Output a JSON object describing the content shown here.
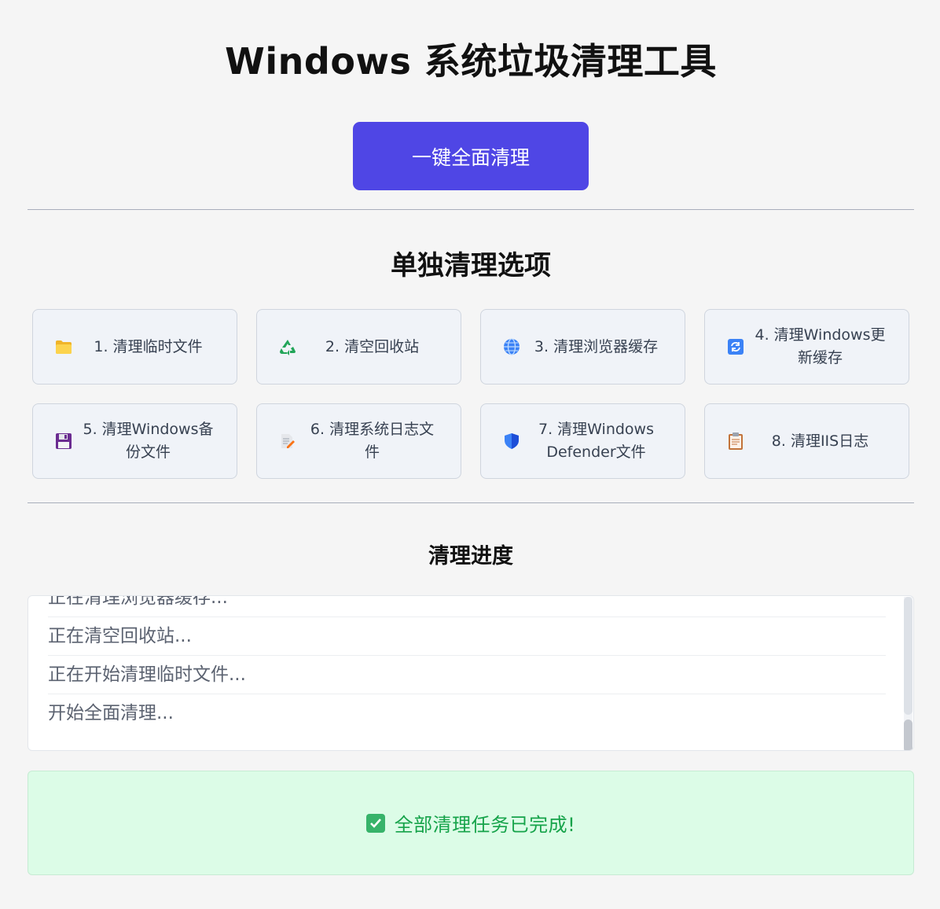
{
  "header": {
    "title": "Windows 系统垃圾清理工具",
    "clean_all_button": "一键全面清理"
  },
  "options": {
    "section_title": "单独清理选项",
    "items": [
      {
        "label": "1. 清理临时文件",
        "icon": "folder-icon"
      },
      {
        "label": "2. 清空回收站",
        "icon": "recycle-icon"
      },
      {
        "label": "3. 清理浏览器缓存",
        "icon": "globe-icon"
      },
      {
        "label": "4. 清理Windows更新缓存",
        "icon": "refresh-icon"
      },
      {
        "label": "5. 清理Windows备份文件",
        "icon": "floppy-disk-icon"
      },
      {
        "label": "6. 清理系统日志文件",
        "icon": "memo-icon"
      },
      {
        "label": "7. 清理Windows Defender文件",
        "icon": "shield-icon"
      },
      {
        "label": "8. 清理IIS日志",
        "icon": "clipboard-icon"
      }
    ]
  },
  "progress": {
    "section_title": "清理进度",
    "log": [
      "正在清理浏览器缓存...",
      "正在清空回收站...",
      "正在开始清理临时文件...",
      "开始全面清理..."
    ]
  },
  "status": {
    "message": "全部清理任务已完成!",
    "icon": "check-mark-icon"
  },
  "colors": {
    "primary": "#4f46e5",
    "success_bg": "#dcfce7",
    "success_text": "#16a34a"
  }
}
